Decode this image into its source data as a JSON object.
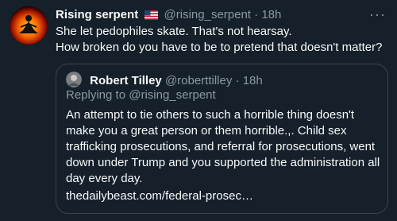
{
  "tweet": {
    "author_name": "Rising serpent",
    "author_handle": "@rising_serpent",
    "separator": "·",
    "time": "18h",
    "more_icon": "more-dots-icon",
    "flag_icon": "us-flag-icon",
    "lines": [
      "She let pedophiles skate. That's not hearsay.",
      "How broken do you have to be to pretend that doesn't matter?"
    ]
  },
  "quote": {
    "author_name": "Robert Tilley",
    "author_handle": "@roberttilley",
    "separator": "·",
    "time": "18h",
    "replying_prefix": "Replying to",
    "replying_handle": "@rising_serpent",
    "text": "An attempt to tie others to such a horrible thing doesn't make you a great person or them horrible.,. Child sex trafficking prosecutions, and referral for prosecutions, went down under Trump and you supported the administration all day every day.",
    "link": "thedailybeast.com/federal-prosec…"
  },
  "colors": {
    "background": "#15202b",
    "text": "#f7f9f9",
    "muted": "#8b98a5",
    "border": "#38444d"
  }
}
